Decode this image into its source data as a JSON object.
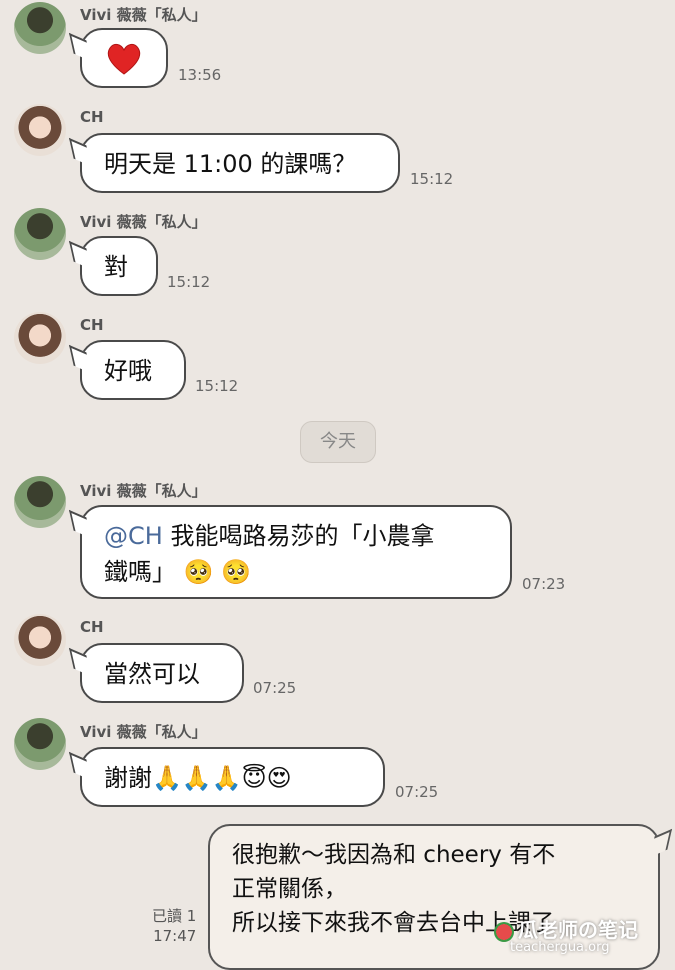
{
  "messages": [
    {
      "sender": "Vivi 薇薇「私人」",
      "text": "",
      "emoji": "heart",
      "time": "13:56"
    },
    {
      "sender": "CH",
      "text": "明天是 11:00 的課嗎？",
      "time": "15:12"
    },
    {
      "sender": "Vivi 薇薇「私人」",
      "text": "對",
      "time": "15:12"
    },
    {
      "sender": "CH",
      "text": "好哦",
      "time": "15:12"
    },
    {
      "sender": "Vivi 薇薇「私人」",
      "mention": "@CH",
      "line1": " 我能喝路易莎的「小農拿",
      "line2": "鐵嗎」",
      "emojis": "🥺 🥺",
      "time": "07:23"
    },
    {
      "sender": "CH",
      "text": "當然可以",
      "time": "07:25"
    },
    {
      "sender": "Vivi 薇薇「私人」",
      "text": "謝謝",
      "emojis": "🙏🙏🙏😇😍",
      "time": "07:25"
    },
    {
      "line1": "很抱歉～我因為和 cheery 有不",
      "line2": "正常關係，",
      "line3": "所以接下來我不會去台中上課了",
      "read": "已讀 1",
      "time": "17:47"
    }
  ],
  "date_divider": "今天",
  "watermark": {
    "title": "瓜老师の笔记",
    "url": "teachergua.org"
  },
  "colors": {
    "background": "#ece7e2",
    "bubble": "#ffffff",
    "mention": "#4a6a9a"
  }
}
